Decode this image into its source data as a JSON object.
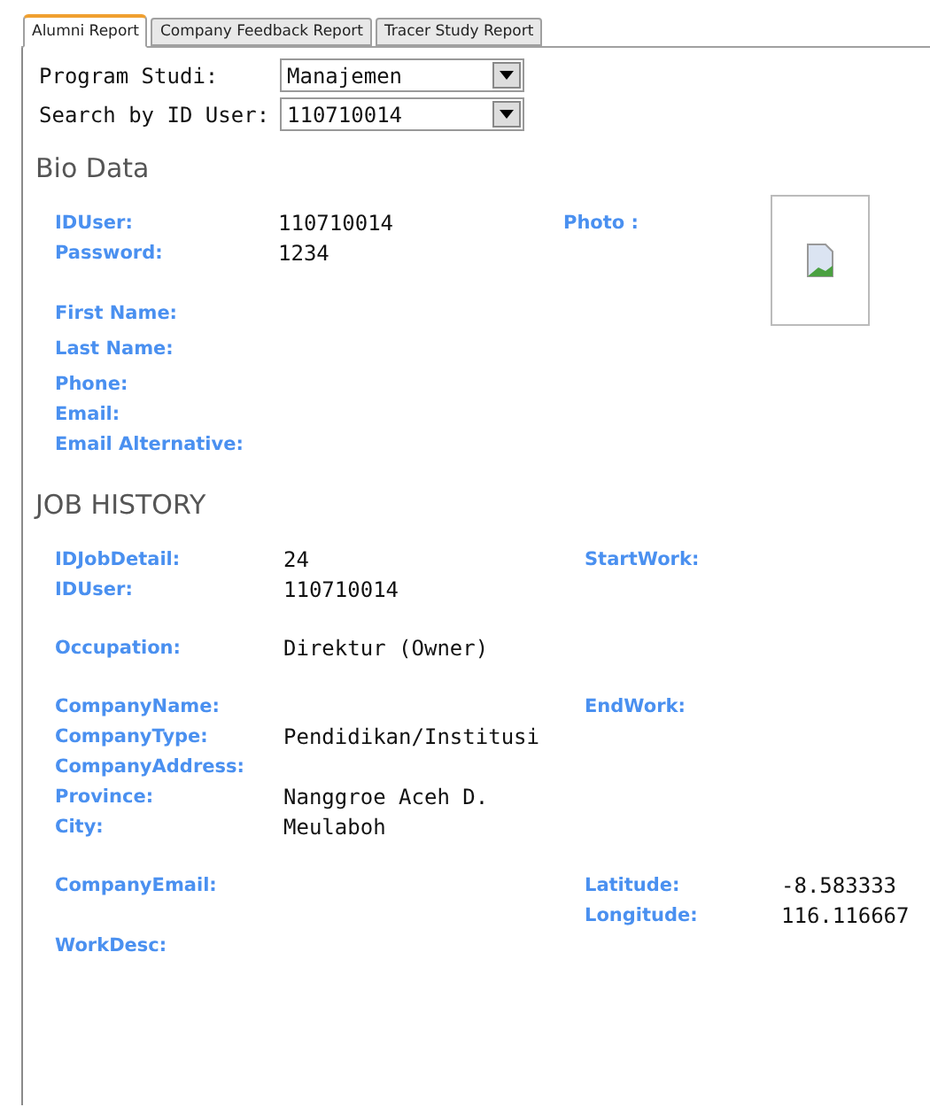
{
  "tabs": [
    {
      "label": "Alumni Report",
      "selected": true
    },
    {
      "label": "Company Feedback Report",
      "selected": false
    },
    {
      "label": "Tracer Study Report",
      "selected": false
    }
  ],
  "filters": [
    {
      "label": "Program Studi:",
      "value": "Manajemen"
    },
    {
      "label": "Search by ID User:",
      "value": "110710014"
    }
  ],
  "bio_data": {
    "title": "Bio Data",
    "photo_label": "Photo :",
    "groups": [
      [
        {
          "label": "IDUser:",
          "value": "110710014"
        },
        {
          "label": "Password:",
          "value": "1234"
        }
      ],
      [
        {
          "label": "First Name:"
        }
      ],
      [
        {
          "label": "Last Name:"
        }
      ],
      [
        {
          "label": "Phone:"
        },
        {
          "label": "Email:"
        },
        {
          "label": "Email Alternative:"
        }
      ]
    ]
  },
  "job_history": {
    "title": "JOB HISTORY",
    "groups": [
      [
        {
          "left": {
            "label": "IDJobDetail:",
            "value": "24"
          },
          "right": {
            "label": "StartWork:"
          }
        },
        {
          "left": {
            "label": "IDUser:",
            "value": "110710014"
          }
        }
      ],
      [
        {
          "left": {
            "label": "Occupation:",
            "value": "Direktur (Owner)"
          }
        }
      ],
      [
        {
          "left": {
            "label": "CompanyName:"
          },
          "right": {
            "label": "EndWork:"
          }
        },
        {
          "left": {
            "label": "CompanyType:",
            "value": "Pendidikan/Institusi"
          }
        },
        {
          "left": {
            "label": "CompanyAddress:"
          }
        },
        {
          "left": {
            "label": "Province:",
            "value": "Nanggroe Aceh D."
          }
        },
        {
          "left": {
            "label": "City:",
            "value": "Meulaboh"
          }
        }
      ],
      [
        {
          "left": {
            "label": "CompanyEmail:"
          },
          "right": {
            "label": "Latitude:",
            "value": "-8.583333"
          }
        },
        {
          "right": {
            "label": "Longitude:",
            "value": "116.116667"
          }
        },
        {
          "left": {
            "label": "WorkDesc:"
          }
        }
      ]
    ]
  }
}
